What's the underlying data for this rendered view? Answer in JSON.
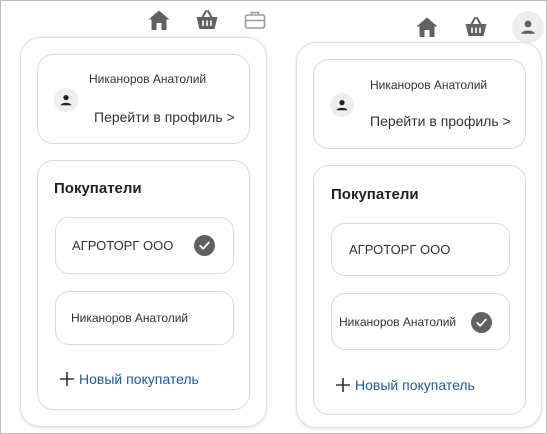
{
  "left": {
    "topbar": {
      "icons": [
        "home-icon",
        "basket-icon",
        "briefcase-icon"
      ]
    },
    "profile": {
      "name": "Никаноров Анатолий",
      "link": "Перейти в профиль >"
    },
    "buyers": {
      "title": "Покупатели",
      "items": [
        {
          "label": "АГРОТОРГ ООО",
          "selected": true
        },
        {
          "label": "Никаноров Анатолий",
          "selected": false
        }
      ],
      "add_label": "Новый покупатель"
    }
  },
  "right": {
    "topbar": {
      "icons": [
        "home-icon",
        "basket-icon",
        "user-icon"
      ]
    },
    "profile": {
      "name": "Никаноров Анатолий",
      "link": "Перейти в профиль >"
    },
    "buyers": {
      "title": "Покупатели",
      "items": [
        {
          "label": "АГРОТОРГ ООО",
          "selected": false
        },
        {
          "label": "Никаноров Анатолий",
          "selected": true
        }
      ],
      "add_label": "Новый покупатель"
    }
  },
  "colors": {
    "icon": "#616161",
    "link": "#1e5b9a",
    "border": "#dcdcdc"
  }
}
